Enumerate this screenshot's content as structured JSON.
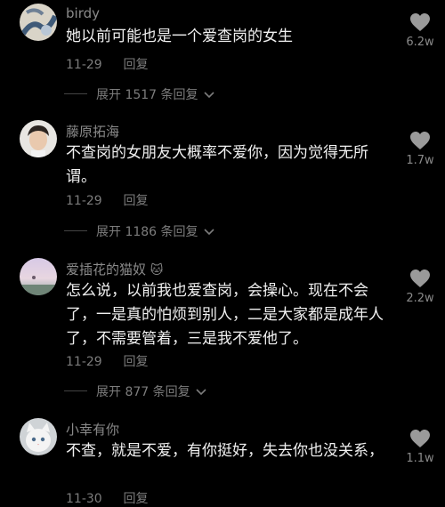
{
  "comments": [
    {
      "username": "birdy",
      "emoji": "",
      "text": "她以前可能也是一个爱查岗的女生",
      "date": "11-29",
      "reply_label": "回复",
      "expand_label": "展开 1517 条回复",
      "likes": "6.2w",
      "avatar_icon": "flower-illustration-avatar"
    },
    {
      "username": "藤原拓海",
      "emoji": "",
      "text": "不查岗的女朋友大概率不爱你，因为觉得无所谓。",
      "date": "11-29",
      "reply_label": "回复",
      "expand_label": "展开 1186 条回复",
      "likes": "1.7w",
      "avatar_icon": "young-man-photo-avatar"
    },
    {
      "username": "爱插花的猫奴",
      "emoji": "🐱",
      "text": "怎么说，以前我也爱查岗，会操心。现在不会了，一是真的怕烦到别人，二是大家都是成年人了，不需要管着，三是我不爱他了。",
      "date": "11-29",
      "reply_label": "回复",
      "expand_label": "展开 877 条回复",
      "likes": "2.2w",
      "avatar_icon": "pastel-sky-avatar"
    },
    {
      "username": "小幸有你",
      "emoji": "",
      "text": "不查，就是不爱，有你挺好，失去你也没关系，",
      "date": "11-30",
      "reply_label": "回复",
      "expand_label": "",
      "likes": "1.1w",
      "avatar_icon": "white-kitten-avatar"
    }
  ],
  "colors": {
    "background": "#000000",
    "text": "#f0f0f0",
    "muted": "#7c7c7c",
    "heart": "#9a9a9a"
  }
}
